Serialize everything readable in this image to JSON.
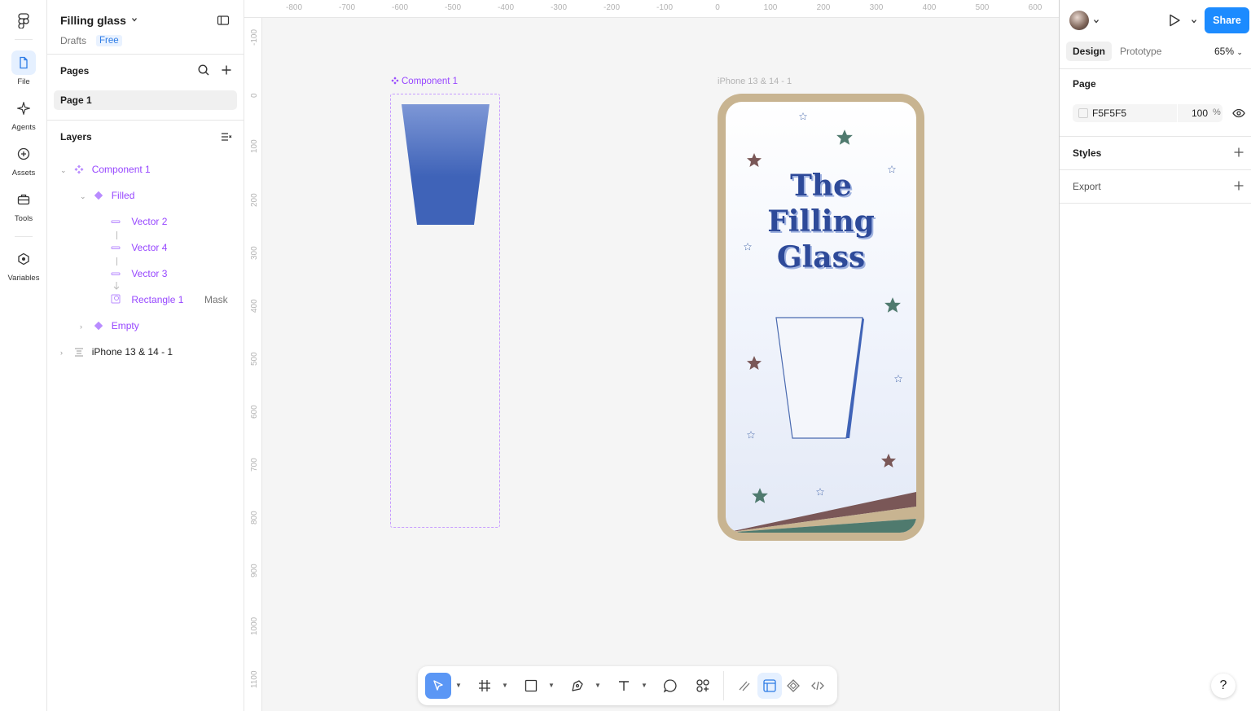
{
  "rail": {
    "items": [
      {
        "label": "File",
        "icon": "file-icon"
      },
      {
        "label": "Agents",
        "icon": "sparkle-icon"
      },
      {
        "label": "Assets",
        "icon": "assets-icon"
      },
      {
        "label": "Tools",
        "icon": "toolbox-icon"
      },
      {
        "label": "Variables",
        "icon": "variables-icon"
      }
    ]
  },
  "file": {
    "title": "Filling glass",
    "location": "Drafts",
    "plan": "Free"
  },
  "pages": {
    "header": "Pages",
    "items": [
      "Page 1"
    ]
  },
  "layers": {
    "header": "Layers",
    "items": [
      {
        "name": "Component 1",
        "type": "component"
      },
      {
        "name": "Filled",
        "type": "instance"
      },
      {
        "name": "Vector 2",
        "type": "vector"
      },
      {
        "name": "Vector 4",
        "type": "vector"
      },
      {
        "name": "Vector 3",
        "type": "vector"
      },
      {
        "name": "Rectangle 1",
        "type": "mask",
        "tag": "Mask"
      },
      {
        "name": "Empty",
        "type": "instance"
      },
      {
        "name": "iPhone 13 & 14 - 1",
        "type": "frame"
      }
    ]
  },
  "canvas": {
    "ruler_x": [
      "-800",
      "-700",
      "-600",
      "-500",
      "-400",
      "-300",
      "-200",
      "-100",
      "0",
      "100",
      "200",
      "300",
      "400",
      "500",
      "600"
    ],
    "ruler_y": [
      "-100",
      "0",
      "100",
      "200",
      "300",
      "400",
      "500",
      "600",
      "700",
      "800",
      "900",
      "1000",
      "1100"
    ],
    "component_label": "Component 1",
    "frame_label": "iPhone 13 & 14 - 1",
    "artwork_title": [
      "The",
      "Filling",
      "Glass"
    ],
    "colors": {
      "glass_fill": "#3f63b8",
      "frame": "#c8b491",
      "star_teal": "#4f7a6e",
      "star_brown": "#7a5757",
      "accent": "#9747ff"
    }
  },
  "toolbar": {
    "tools": [
      "move-tool",
      "frame-tool",
      "shape-tool",
      "pen-tool",
      "text-tool",
      "comment-tool",
      "actions-tool",
      "draw-mode",
      "design-mode",
      "component-mode",
      "dev-mode"
    ]
  },
  "right": {
    "share_label": "Share",
    "tabs": {
      "design": "Design",
      "prototype": "Prototype"
    },
    "zoom": "65%",
    "page_section": "Page",
    "page_color": "F5F5F5",
    "page_opacity": "100",
    "opacity_unit": "%",
    "styles_section": "Styles",
    "export_section": "Export",
    "help": "?"
  }
}
